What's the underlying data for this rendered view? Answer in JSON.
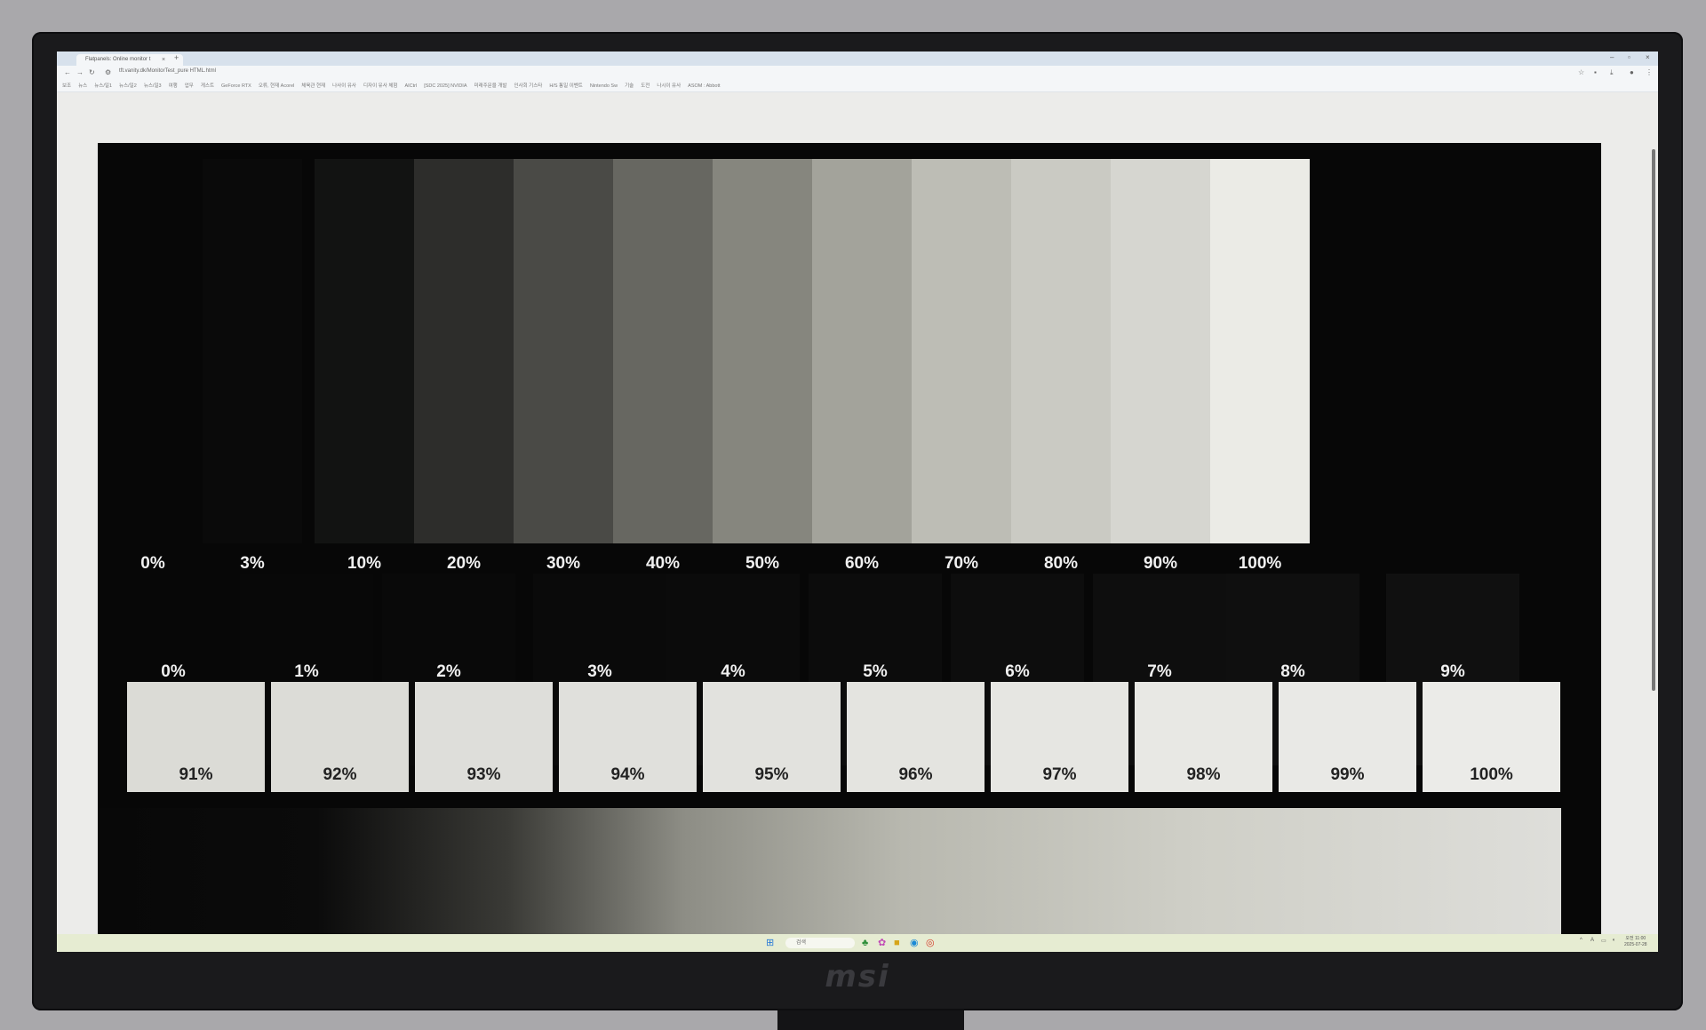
{
  "browser": {
    "tab_title": "Flatpanels: Online monitor t",
    "tab_close": "×",
    "new_tab": "+",
    "url": "tft.vanity.dk/MonitorTest_pure HTML.html",
    "bookmarks": [
      "보조",
      "뉴스",
      "뉴스/일1",
      "뉴스/일2",
      "뉴스/일3",
      "여행",
      "업무",
      "게스트",
      "GeForce RTX",
      "오류, 현재 Acorel",
      "체육관 현재",
      "나사이 유사",
      "디자이 유사 체험",
      "AICtrl",
      "[SDC 2025] NVIDIA",
      "미래주문을 개발",
      "인사회 기스타",
      "H/S 통일 이벤트",
      "Nintendo Sw",
      "기술",
      "도전",
      "나시이 유사",
      "ASOM : Abbott"
    ],
    "window_controls": [
      "–",
      "▫",
      "×"
    ]
  },
  "test": {
    "bars": [
      {
        "label": "0%",
        "color": "#070707"
      },
      {
        "label": "3%",
        "color": "#0a0a0a"
      },
      {
        "label": "10%",
        "color": "#121312"
      },
      {
        "label": "20%",
        "color": "#2d2d2b"
      },
      {
        "label": "30%",
        "color": "#4a4a46"
      },
      {
        "label": "40%",
        "color": "#676761"
      },
      {
        "label": "50%",
        "color": "#86867e"
      },
      {
        "label": "60%",
        "color": "#a3a39b"
      },
      {
        "label": "70%",
        "color": "#bdbdb5"
      },
      {
        "label": "80%",
        "color": "#cacac3"
      },
      {
        "label": "90%",
        "color": "#d6d6d0"
      },
      {
        "label": "100%",
        "color": "#ebebe6"
      }
    ],
    "dark_steps": [
      {
        "label": "0%",
        "color": "#070707"
      },
      {
        "label": "1%",
        "color": "#080808"
      },
      {
        "label": "2%",
        "color": "#090909"
      },
      {
        "label": "3%",
        "color": "#0a0a0a"
      },
      {
        "label": "4%",
        "color": "#0b0b0b"
      },
      {
        "label": "5%",
        "color": "#0c0c0c"
      },
      {
        "label": "6%",
        "color": "#0d0d0d"
      },
      {
        "label": "7%",
        "color": "#0e0e0e"
      },
      {
        "label": "8%",
        "color": "#0f0f0f"
      },
      {
        "label": "9%",
        "color": "#101010"
      }
    ],
    "light_steps": [
      {
        "label": "91%",
        "color": "#dbdbd6"
      },
      {
        "label": "92%",
        "color": "#dcdcd7"
      },
      {
        "label": "93%",
        "color": "#dededa"
      },
      {
        "label": "94%",
        "color": "#e0e0dc"
      },
      {
        "label": "95%",
        "color": "#e2e2de"
      },
      {
        "label": "96%",
        "color": "#e4e4e0"
      },
      {
        "label": "97%",
        "color": "#e6e6e2"
      },
      {
        "label": "98%",
        "color": "#e8e8e4"
      },
      {
        "label": "99%",
        "color": "#e9e9e6"
      },
      {
        "label": "100%",
        "color": "#ebebe8"
      }
    ]
  },
  "taskbar": {
    "search_placeholder": "검색",
    "clock_time": "오전 11:00",
    "clock_date": "2025-07-28"
  },
  "monitor": {
    "brand": "msi"
  }
}
